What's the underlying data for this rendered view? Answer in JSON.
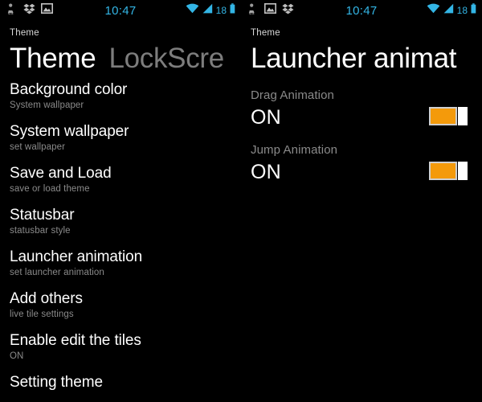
{
  "left_panel": {
    "statusbar": {
      "icons": [
        "contacts-21-icon",
        "dropbox-icon",
        "gallery-image-icon"
      ],
      "clock": "10:47",
      "wifi_icon": "wifi-icon",
      "signal_icon": "signal-bars-icon",
      "battery_level": "18",
      "battery_icon": "battery-icon"
    },
    "breadcrumb": "Theme",
    "tabs": [
      {
        "label": "Theme",
        "active": true
      },
      {
        "label": "LockScre",
        "active": false
      }
    ],
    "items": [
      {
        "title": "Background color",
        "subtitle": "System wallpaper"
      },
      {
        "title": "System wallpaper",
        "subtitle": "set wallpaper"
      },
      {
        "title": "Save and Load",
        "subtitle": "save or load theme"
      },
      {
        "title": "Statusbar",
        "subtitle": "statusbar style"
      },
      {
        "title": "Launcher animation",
        "subtitle": "set launcher animation"
      },
      {
        "title": "Add others",
        "subtitle": "live tile settings"
      },
      {
        "title": "Enable edit the tiles",
        "subtitle": "ON"
      },
      {
        "title": "Setting theme",
        "subtitle": ""
      }
    ]
  },
  "right_panel": {
    "statusbar": {
      "icons": [
        "contacts-21-icon",
        "gallery-image-icon",
        "dropbox-icon"
      ],
      "clock": "10:47",
      "wifi_icon": "wifi-icon",
      "signal_icon": "signal-bars-icon",
      "battery_level": "18",
      "battery_icon": "battery-icon"
    },
    "breadcrumb": "Theme",
    "title": "Launcher animat",
    "toggles": [
      {
        "label": "Drag Animation",
        "state": "ON"
      },
      {
        "label": "Jump Animation",
        "state": "ON"
      }
    ]
  },
  "colors": {
    "background": "#000000",
    "accent_blue": "#33b5e5",
    "toggle_on": "#f49a0b",
    "text_primary": "#ffffff",
    "text_secondary": "#8a8a8a",
    "tab_inactive": "#7d7d7d"
  }
}
